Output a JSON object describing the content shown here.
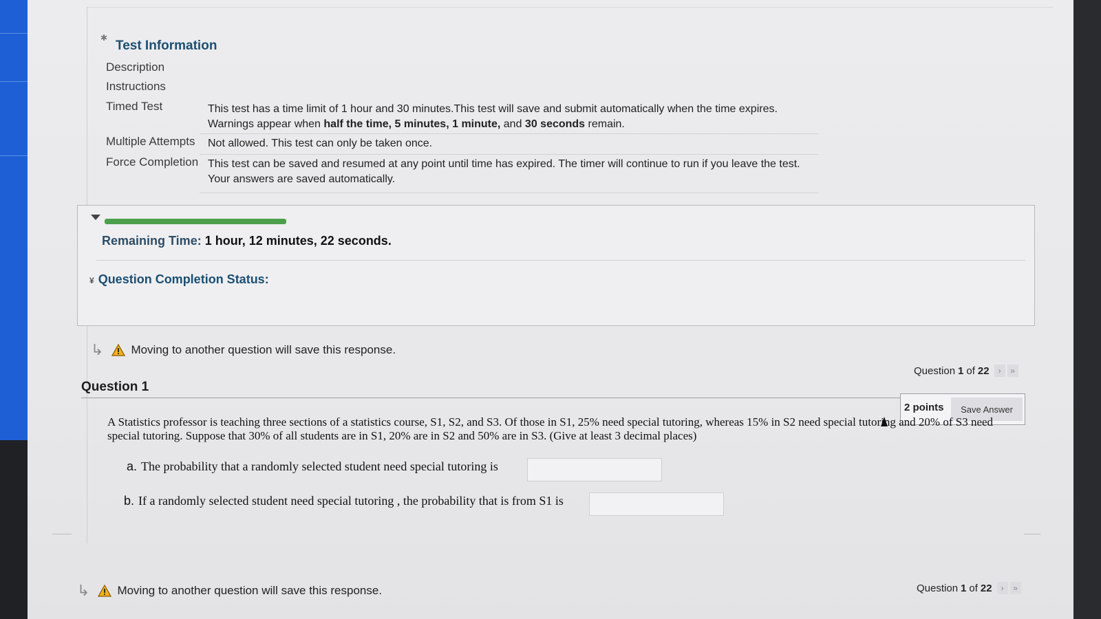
{
  "test_info": {
    "title": "Test Information",
    "rows": [
      {
        "label": "Description",
        "value": ""
      },
      {
        "label": "Instructions",
        "value": ""
      },
      {
        "label": "Timed Test",
        "value_line1": "This test has a time limit of 1 hour and 30 minutes.This test will save and submit automatically when the time expires.",
        "value_line2_prefix": "Warnings appear when ",
        "value_line2_b1": "half the time, 5 minutes, 1 minute,",
        "value_line2_mid": " and ",
        "value_line2_b2": "30 seconds",
        "value_line2_suffix": " remain."
      },
      {
        "label": "Multiple Attempts",
        "value": "Not allowed. This test can only be taken once."
      },
      {
        "label": "Force Completion",
        "value_line1": "This test can be saved and resumed at any point until time has expired. The timer will continue to run if you leave the test.",
        "value_line2": "Your answers are saved automatically."
      }
    ]
  },
  "timer": {
    "progress_fraction": 0.2,
    "remaining_label": "Remaining Time:",
    "remaining_value": "1 hour, 12 minutes, 22 seconds."
  },
  "completion_status": {
    "label": "Question Completion Status:"
  },
  "warning_text": "Moving to another question will save this response.",
  "nav": {
    "prefix": "Question",
    "current": "1",
    "of": "of",
    "total": "22",
    "next": "›",
    "last": "»"
  },
  "question": {
    "title": "Question 1",
    "points": "2 points",
    "save_label": "Save Answer",
    "text": "A Statistics professor is teaching three sections of a statistics course, S1, S2, and S3. Of those in S1, 25% need special tutoring, whereas 15% in S2 need special tutoring and 20% of S3 need special tutoring.  Suppose that 30% of all students are in S1, 20% are in S2 and 50% are in S3. (Give at least 3 decimal places)",
    "part_a_letter": "a.",
    "part_a": "The probability that a randomly selected student need special tutoring  is",
    "part_b_letter": "b.",
    "part_b": "If a randomly selected student need special tutoring , the probability that is from S1 is",
    "answer_a": "",
    "answer_b": ""
  },
  "colors": {
    "accent": "#1b4f72",
    "progress": "#4c9f4c",
    "left_bar": "#1e5fd6"
  }
}
